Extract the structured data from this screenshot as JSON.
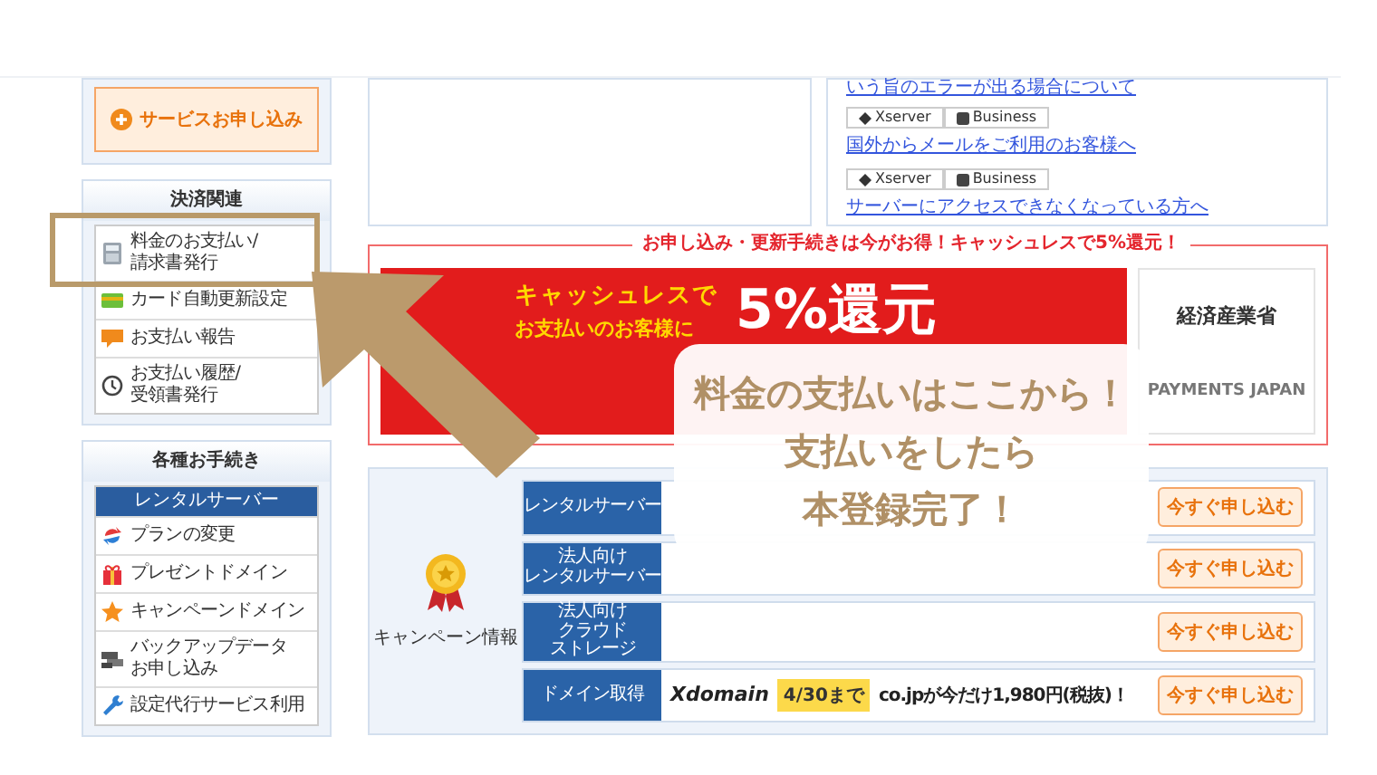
{
  "sidebar": {
    "apply_button": "サービスお申し込み",
    "sections": [
      {
        "title": "決済関連",
        "items": [
          {
            "lines": [
              "料金のお支払い/",
              "請求書発行"
            ]
          },
          {
            "lines": [
              "カード自動更新設定"
            ]
          },
          {
            "lines": [
              "お支払い報告"
            ]
          },
          {
            "lines": [
              "お支払い履歴/",
              "受領書発行"
            ]
          }
        ]
      },
      {
        "title": "各種お手続き",
        "subheader": "レンタルサーバー",
        "items": [
          {
            "lines": [
              "プランの変更"
            ]
          },
          {
            "lines": [
              "プレゼントドメイン"
            ]
          },
          {
            "lines": [
              "キャンペーンドメイン"
            ]
          },
          {
            "lines": [
              "バックアップデータ",
              "お申し込み"
            ]
          },
          {
            "lines": [
              "設定代行サービス利用"
            ]
          }
        ]
      }
    ]
  },
  "notices": [
    {
      "text": "いう旨のエラーが出る場合について"
    },
    {
      "tags": [
        "Xserver",
        "Business"
      ],
      "text": "国外からメールをご利用のお客様へ"
    },
    {
      "tags": [
        "Xserver",
        "Business"
      ],
      "text": "サーバーにアクセスできなくなっている方へ"
    }
  ],
  "promo": {
    "heading": "お申し込み・更新手続きは今がお得！キャッシュレスで5%還元！",
    "banner_lines": [
      "キャッシュレスで",
      "お支払いのお客様に"
    ],
    "banner_big": "5%還元",
    "logos": [
      "経済産業省",
      "PAYMENTS JAPAN"
    ]
  },
  "campaign": {
    "title": "キャンペーン情報",
    "rows": [
      {
        "category": [
          "レンタルサーバー"
        ],
        "button": "今すぐ申し込む"
      },
      {
        "category": [
          "法人向け",
          "レンタルサーバー"
        ],
        "button": "今すぐ申し込む"
      },
      {
        "category": [
          "法人向け",
          "クラウド",
          "ストレージ"
        ],
        "button": "今すぐ申し込む"
      },
      {
        "category": [
          "ドメイン取得"
        ],
        "logo": "Xdomain",
        "deadline": "4/30まで",
        "offer": "co.jpが今だけ**1,980円(税抜)**！",
        "button": "今すぐ申し込む"
      }
    ]
  },
  "annotation": {
    "callout": [
      "料金の支払いはここから！",
      "支払いをしたら",
      "本登録完了！"
    ]
  }
}
